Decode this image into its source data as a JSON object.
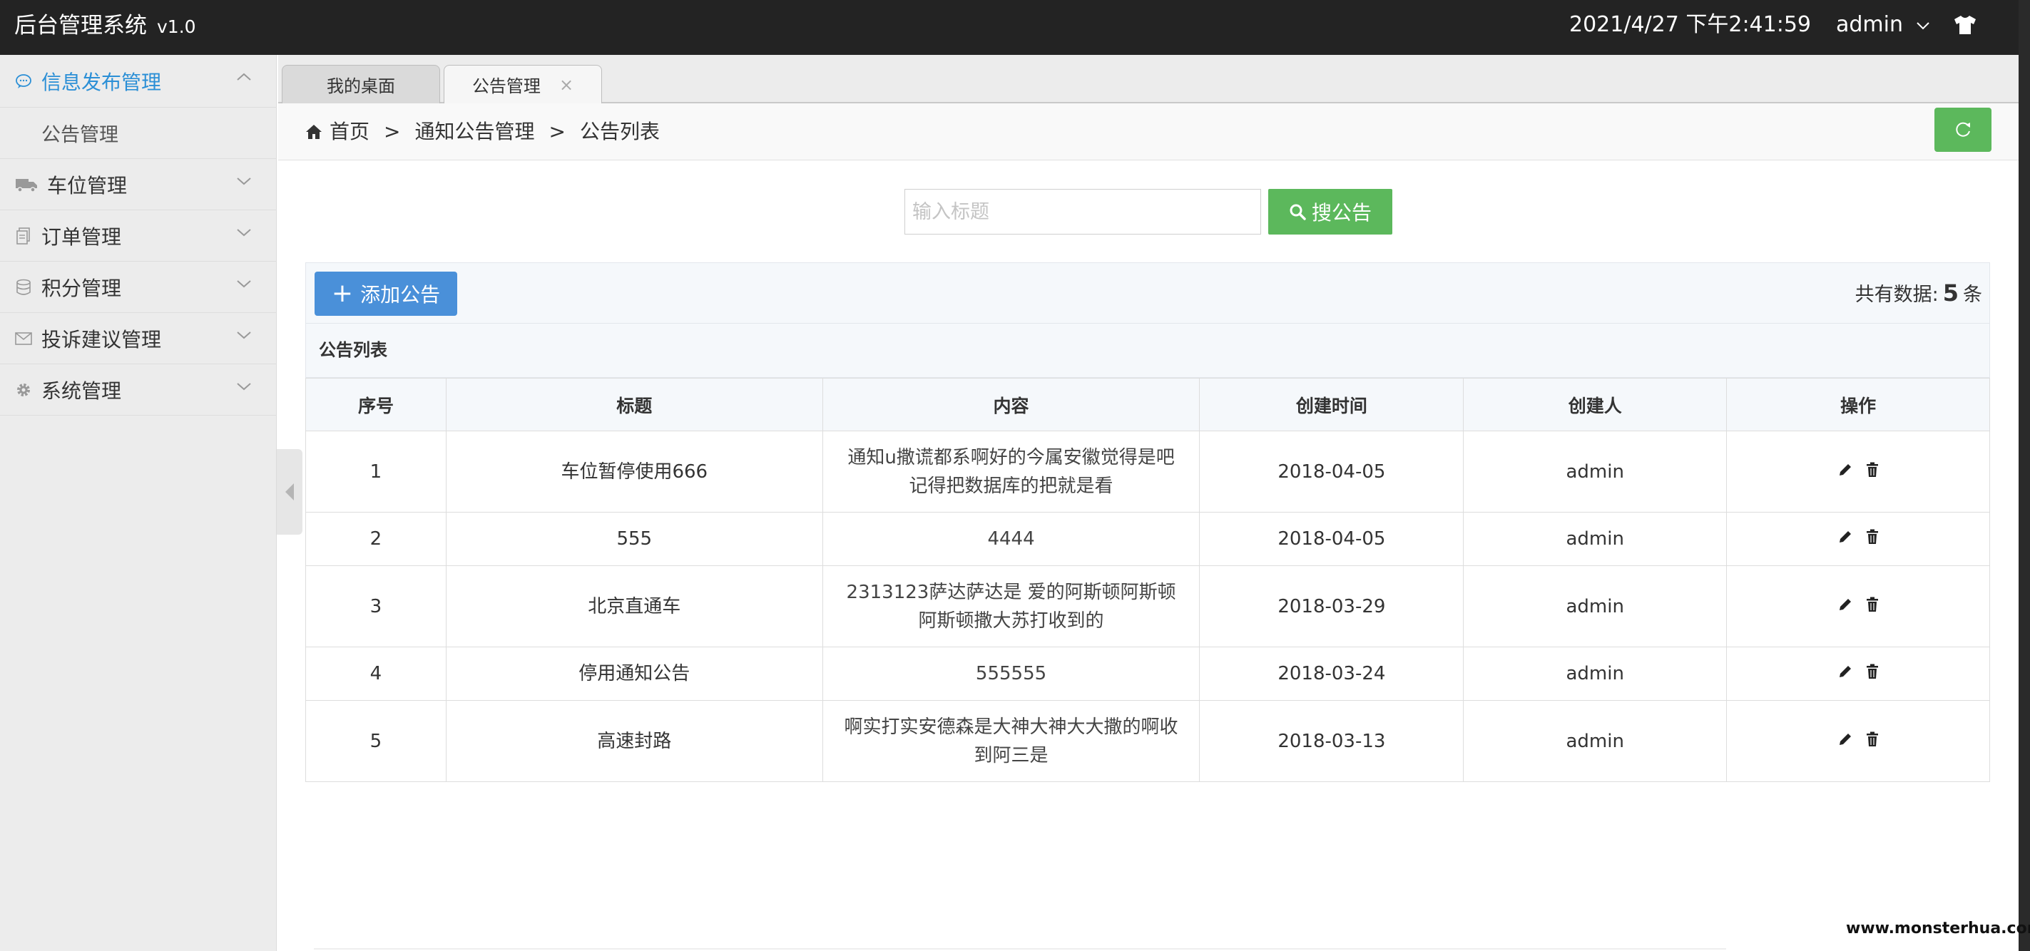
{
  "header": {
    "app_title": "后台管理系统",
    "version": "v1.0",
    "datetime": "2021/4/27 下午2:41:59",
    "username": "admin",
    "icons": {
      "user_menu": "chevron-down-icon",
      "skin": "tshirt-icon"
    }
  },
  "sidebar": {
    "items": [
      {
        "label": "信息发布管理",
        "icon": "chat-icon",
        "expanded": true,
        "active": true,
        "children": [
          {
            "label": "公告管理"
          }
        ]
      },
      {
        "label": "车位管理",
        "icon": "truck-icon"
      },
      {
        "label": "订单管理",
        "icon": "document-icon"
      },
      {
        "label": "积分管理",
        "icon": "database-icon"
      },
      {
        "label": "投诉建议管理",
        "icon": "envelope-icon"
      },
      {
        "label": "系统管理",
        "icon": "gear-icon"
      }
    ]
  },
  "tabs": [
    {
      "label": "我的桌面",
      "active": false
    },
    {
      "label": "公告管理",
      "active": true,
      "close": "×"
    }
  ],
  "breadcrumb": {
    "items": [
      "首页",
      "通知公告管理",
      "公告列表"
    ],
    "separator": ">"
  },
  "search": {
    "placeholder": "输入标题",
    "value": "",
    "button_label": "搜公告"
  },
  "toolbar": {
    "add_label": "添加公告",
    "count_prefix": "共有数据:",
    "count": "5",
    "count_suffix": "条"
  },
  "table": {
    "caption": "公告列表",
    "headers": [
      "序号",
      "标题",
      "内容",
      "创建时间",
      "创建人",
      "操作"
    ],
    "rows": [
      {
        "id": "1",
        "title": "车位暂停使用666",
        "content": "通知u撒谎都系啊好的今属安徽觉得是吧记得把数据库的把就是看",
        "created": "2018-04-05",
        "creator": "admin"
      },
      {
        "id": "2",
        "title": "555",
        "content": "4444",
        "created": "2018-04-05",
        "creator": "admin"
      },
      {
        "id": "3",
        "title": "北京直通车",
        "content": "2313123萨达萨达是 爱的阿斯顿阿斯顿阿斯顿撒大苏打收到的",
        "created": "2018-03-29",
        "creator": "admin"
      },
      {
        "id": "4",
        "title": "停用通知公告",
        "content": "555555",
        "created": "2018-03-24",
        "creator": "admin"
      },
      {
        "id": "5",
        "title": "高速封路",
        "content": "啊实打实安德森是大神大神大大撒的啊收到阿三是",
        "created": "2018-03-13",
        "creator": "admin"
      }
    ],
    "row_actions": [
      "edit-icon",
      "delete-icon"
    ]
  },
  "watermark": "www.monsterhua.com",
  "colors": {
    "accent_blue": "#4a90d9",
    "active_link": "#2b8fd6",
    "success_green": "#5cb85c",
    "topbar": "#232323"
  }
}
